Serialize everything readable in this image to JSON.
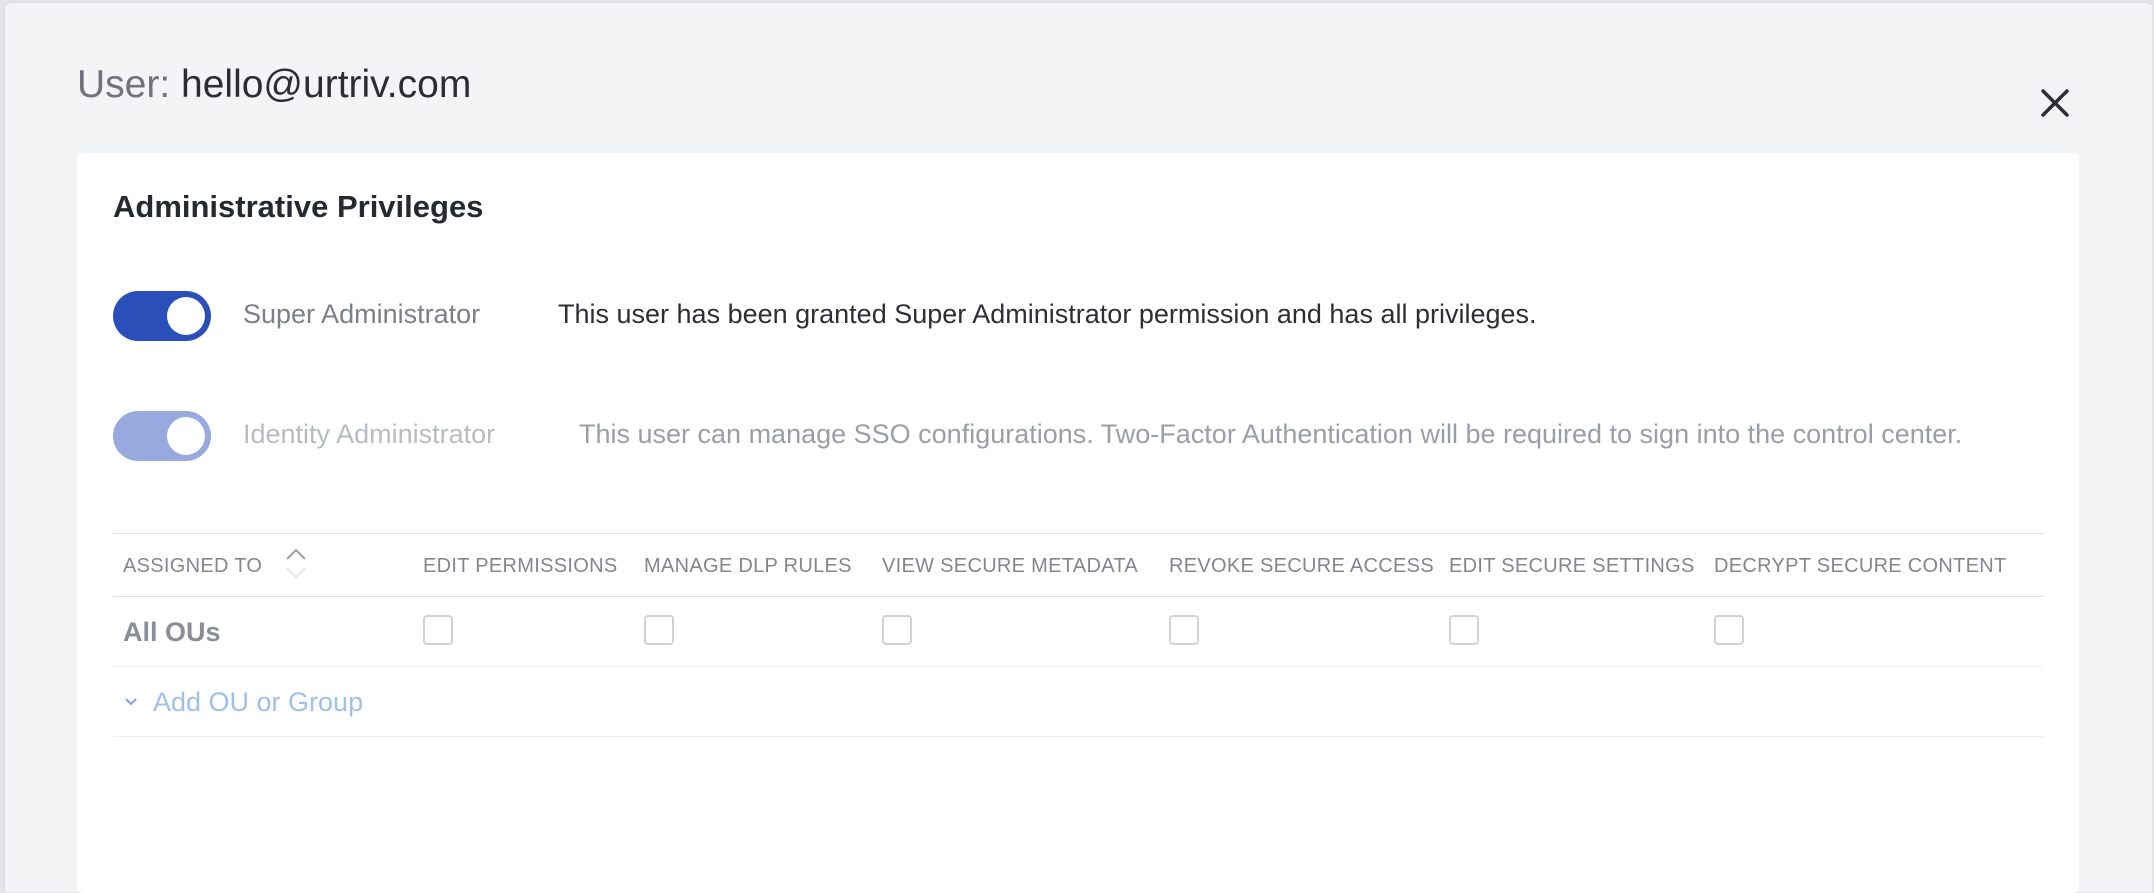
{
  "header": {
    "prefix": "User:",
    "email": "hello@urtriv.com"
  },
  "icons": {
    "close": "close-icon",
    "sort": "sort-icon",
    "chevron": "chevron-down-icon"
  },
  "colors": {
    "toggle_on": "#2a4fb8",
    "toggle_disabled": "#97a9de",
    "link": "#9ec0ea"
  },
  "section": {
    "title": "Administrative Privileges"
  },
  "privileges": [
    {
      "label": "Super Administrator",
      "description": "This user has been granted Super Administrator permission and has all privileges.",
      "enabled": true,
      "disabled": false
    },
    {
      "label": "Identity Administrator",
      "description": "This user can manage SSO configurations. Two-Factor Authentication will be required to sign into the control center.",
      "enabled": true,
      "disabled": true
    }
  ],
  "table": {
    "columns": [
      "ASSIGNED TO",
      "EDIT PERMISSIONS",
      "MANAGE DLP RULES",
      "VIEW SECURE METADATA",
      "REVOKE SECURE ACCESS",
      "EDIT SECURE SETTINGS",
      "DECRYPT SECURE CONTENT"
    ],
    "rows": [
      {
        "name": "All OUs",
        "checks": [
          false,
          false,
          false,
          false,
          false,
          false
        ]
      }
    ],
    "add_label": "Add OU or Group"
  }
}
